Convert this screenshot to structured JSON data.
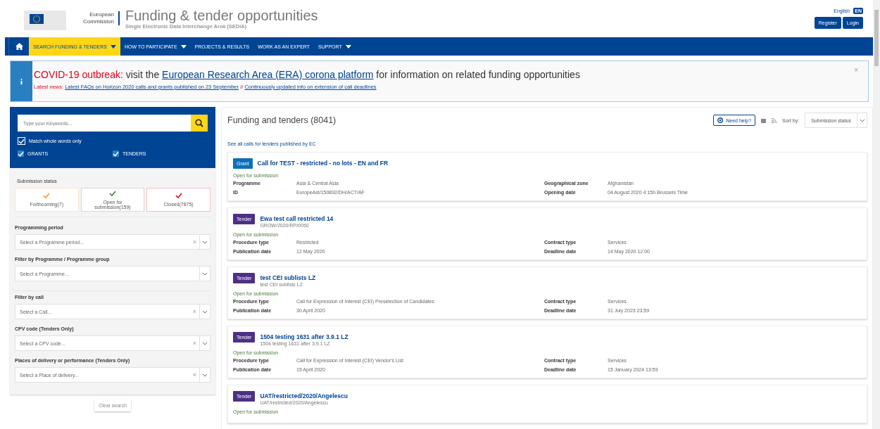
{
  "header": {
    "logo_line_1": "European",
    "logo_line_2": "Commission",
    "title": "Funding & tender opportunities",
    "subtitle": "Single Electronic Data Interchange Area (SEDIA)",
    "language": "English",
    "language_badge": "EN",
    "buttons": [
      "Register",
      "Login"
    ]
  },
  "nav": [
    {
      "label": "SEARCH FUNDING & TENDERS",
      "dropdown": true,
      "selected": true
    },
    {
      "label": "HOW TO PARTICIPATE",
      "dropdown": true,
      "selected": false
    },
    {
      "label": "PROJECTS & RESULTS",
      "dropdown": false,
      "selected": false
    },
    {
      "label": "WORK AS AN EXPERT",
      "dropdown": false,
      "selected": false
    },
    {
      "label": "SUPPORT",
      "dropdown": true,
      "selected": false
    }
  ],
  "alert": {
    "lead": "COVID-19 outbreak:",
    "text_before": "visit the",
    "link": "European Research Area (ERA) corona platform",
    "text_after": "for information on related funding opportunities",
    "news_label": "Latest news:",
    "news_links": [
      "Latest FAQs on Horizon 2020 calls and grants published on 23 September",
      "Continuously updated info on extension of call deadlines"
    ],
    "separator": "//",
    "close": "×"
  },
  "search": {
    "placeholder": "Type your Keywords...",
    "options": [
      {
        "label": "Match whole words only",
        "checked": true
      },
      {
        "label": "GRANTS",
        "checked": true
      },
      {
        "label": "TENDERS",
        "checked": true
      }
    ]
  },
  "submission_status": {
    "label": "Submission status",
    "items": [
      {
        "label": "Forthcoming(7)",
        "color": "#f29527",
        "selected": true
      },
      {
        "label": "Open for submission(159)",
        "color": "#467a39",
        "selected": true
      },
      {
        "label": "Closed(7875)",
        "color": "#e3001b",
        "selected": true
      }
    ]
  },
  "filters": [
    {
      "label": "Programming period",
      "placeholder": "Select a Programme period...",
      "clear": "×"
    },
    {
      "label": "Filter by Programme / Programme group",
      "placeholder": "Select a Programme..."
    },
    {
      "label": "Filter by call",
      "placeholder": "Select a Call...",
      "clear": "×"
    },
    {
      "label": "CPV code (Tenders Only)",
      "placeholder": "Select a CPV code...",
      "clear": "×"
    },
    {
      "label": "Places of delivery or performance (Tenders Only)",
      "placeholder": "Select a Place of delivery...",
      "clear": "×"
    }
  ],
  "clear_button": "Clear search",
  "results": {
    "title": "Funding and tenders (8041)",
    "help_button": "Need help?",
    "sort_label": "Sort by:",
    "sort_value": "Submission status",
    "ec_link": "See all calls for tenders published by EC",
    "cards": [
      {
        "kind": "grant",
        "badge": "Grant",
        "title": "Call for TEST - restricted - no lots - EN and FR",
        "status": "Open for submission",
        "fields": [
          [
            "Programme",
            "Asia & Central Asia",
            "Geographical zone",
            "Afghanistan"
          ],
          [
            "ID",
            "EuropeAid/150892/DH/ACT/AF",
            "Opening date",
            "04 August 2020 4:15h Brussels Time"
          ]
        ]
      },
      {
        "kind": "tender",
        "badge": "Tender",
        "title": "Ewa test call restricted 14",
        "subtitle": "GROW/2020/RP/0050",
        "status": "Open for submission",
        "fields": [
          [
            "Procedure type",
            "Restricted",
            "Contract type",
            "Services"
          ],
          [
            "Publication date",
            "12 May 2020",
            "Deadline date",
            "14 May 2020 12:00"
          ]
        ]
      },
      {
        "kind": "tender",
        "badge": "Tender",
        "title": "test CEI sublists LZ",
        "subtitle": "test CEI sublists LZ",
        "status": "Open for submission",
        "fields": [
          [
            "Procedure type",
            "Call for Expression of Interest (CEI) Preselection of Candidates",
            "Contract type",
            "Services"
          ],
          [
            "Publication date",
            "30 April 2020",
            "Deadline date",
            "31 July 2023 23:59"
          ]
        ]
      },
      {
        "kind": "tender",
        "badge": "Tender",
        "title": "1504 testing 1631 after 3.9.1 LZ",
        "subtitle": "1504 testing 1631 after 3.9.1 LZ",
        "status": "Open for submission",
        "fields": [
          [
            "Procedure type",
            "Call for Expression of Interest (CEI) Vendor's List",
            "Contract type",
            "Services"
          ],
          [
            "Publication date",
            "15 April 2020",
            "Deadline date",
            "15 January 2024 13:59"
          ]
        ]
      },
      {
        "kind": "tender",
        "badge": "Tender",
        "title": "UAT/restricted/2020/Angelescu",
        "subtitle": "UAT/restricted/2020/Angelescu",
        "status": "Open for submission"
      }
    ]
  }
}
